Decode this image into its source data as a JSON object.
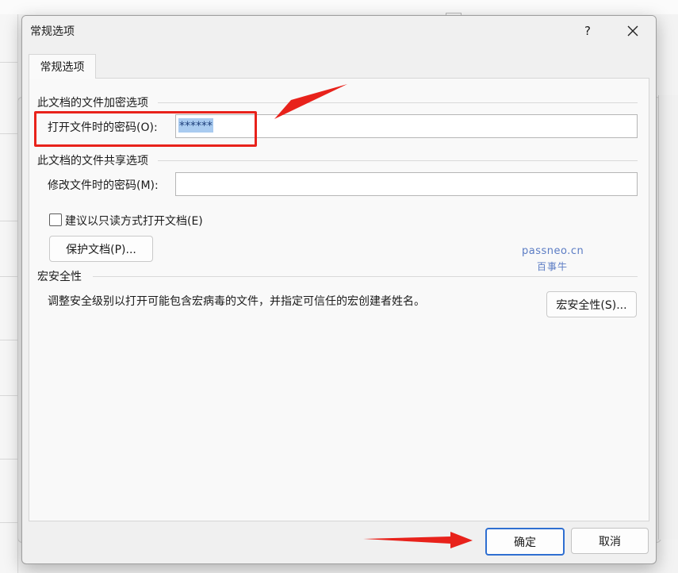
{
  "window": {
    "title": "常规选项",
    "help_label": "?"
  },
  "tab": {
    "label": "常规选项"
  },
  "encryption": {
    "group_label": "此文档的文件加密选项",
    "open_password_label": "打开文件时的密码(O):",
    "open_password_value": "******"
  },
  "sharing": {
    "group_label": "此文档的文件共享选项",
    "modify_password_label": "修改文件时的密码(M):",
    "modify_password_value": "",
    "readonly_label": "建议以只读方式打开文档(E)",
    "readonly_checked": false,
    "protect_button": "保护文档(P)..."
  },
  "macro": {
    "group_label": "宏安全性",
    "description": "调整安全级别以打开可能包含宏病毒的文件，并指定可信任的宏创建者姓名。",
    "button": "宏安全性(S)..."
  },
  "watermark": {
    "line1": "passneo.cn",
    "line2": "百事牛"
  },
  "footer": {
    "ok_label": "确定",
    "cancel_label": "取消"
  },
  "colors": {
    "annotation_red": "#e8221b",
    "selection_blue": "#a9cbf0",
    "watermark_blue": "#5b7cc4"
  }
}
